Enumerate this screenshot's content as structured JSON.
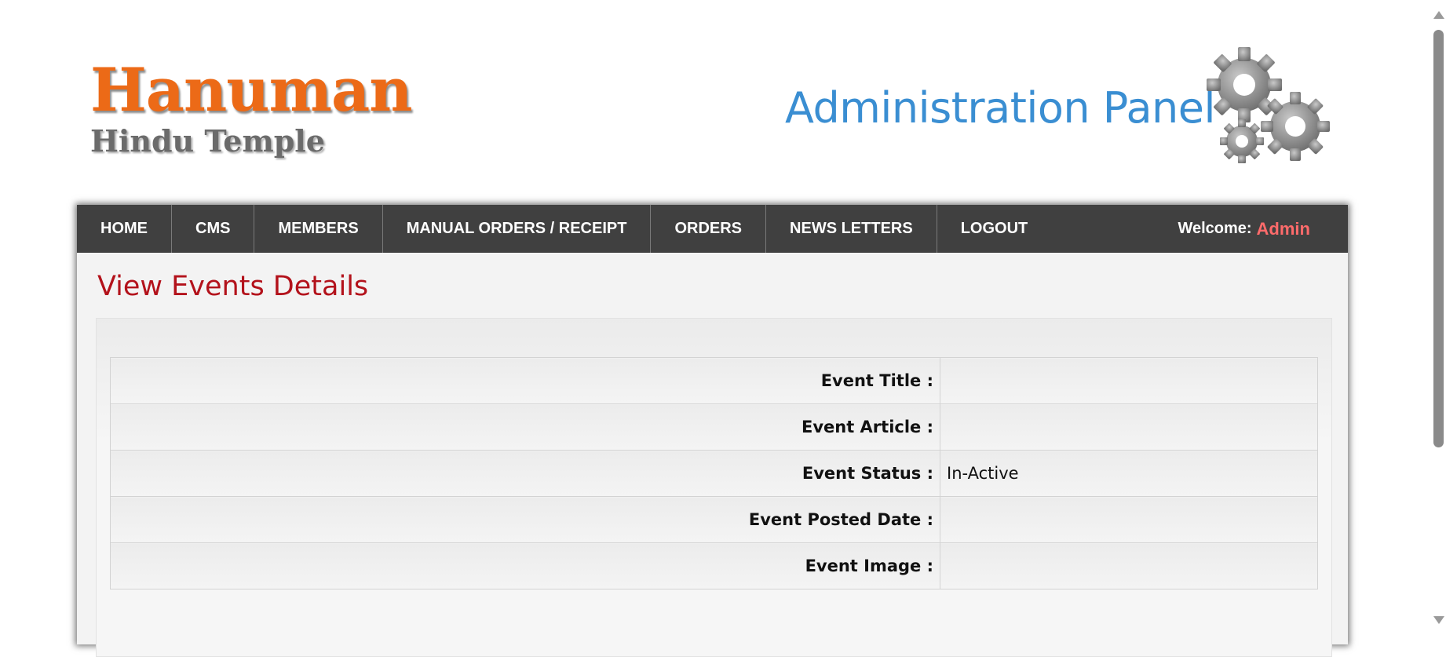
{
  "logo": {
    "title": "Hanuman",
    "subtitle": "Hindu Temple"
  },
  "header": {
    "admin_title": "Administration Panel",
    "gears_icon": "gears-icon"
  },
  "nav": {
    "items": [
      {
        "label": "HOME"
      },
      {
        "label": "CMS"
      },
      {
        "label": "MEMBERS"
      },
      {
        "label": "MANUAL ORDERS / RECEIPT"
      },
      {
        "label": "ORDERS"
      },
      {
        "label": "NEWS LETTERS"
      },
      {
        "label": "LOGOUT"
      }
    ],
    "welcome_label": "Welcome:",
    "welcome_user": "Admin"
  },
  "page": {
    "title": "View Events Details"
  },
  "details": {
    "rows": [
      {
        "label": "Event Title :",
        "value": ""
      },
      {
        "label": "Event Article :",
        "value": ""
      },
      {
        "label": "Event Status :",
        "value": "In-Active"
      },
      {
        "label": "Event Posted Date :",
        "value": ""
      },
      {
        "label": "Event Image :",
        "value": ""
      }
    ]
  },
  "colors": {
    "logo_orange": "#ec6a17",
    "admin_blue": "#3a8ed2",
    "nav_bg": "#404040",
    "title_red": "#b3121b",
    "welcome_user": "#ff6b6b"
  }
}
